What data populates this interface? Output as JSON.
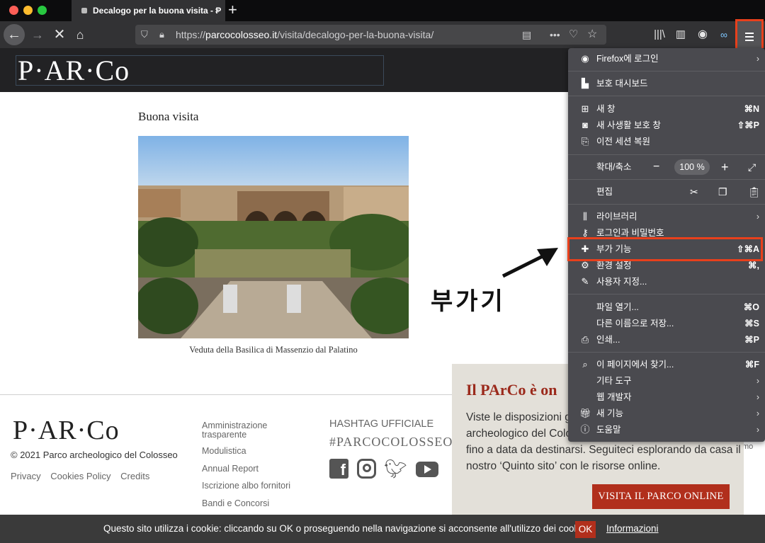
{
  "tab": {
    "title": "Decalogo per la buona visita - P",
    "close": "×",
    "new_tab": "+"
  },
  "nav": {
    "url_prefix": "https://",
    "url_domain": "parcocolosseo.it",
    "url_path": "/visita/decalogo-per-la-buona-visita/"
  },
  "site": {
    "logo": "P·AR·Co"
  },
  "content": {
    "title": "Buona visita",
    "caption": "Veduta della Basilica di Massenzio dal Palatino",
    "annotation": "부가기"
  },
  "footer": {
    "logo": "P·AR·Co",
    "copyright": "© 2021 Parco archeologico del Colosseo",
    "links": [
      "Privacy",
      "Cookies Policy",
      "Credits"
    ],
    "col_links": [
      "Amministrazione trasparente",
      "Modulistica",
      "Annual Report",
      "Iscrizione albo fornitori",
      "Bandi e Concorsi"
    ],
    "hashtag_title": "HASHTAG UFFICIALE",
    "hashtag": "#PARCOCOLOSSEO",
    "social": [
      "facebook-icon",
      "instagram-icon",
      "twitter-icon",
      "youtube-icon"
    ],
    "partial_text": "mo"
  },
  "popup": {
    "title": "Il PArCo è on",
    "body": "Viste le disposizioni go archeologico del Colo fino a data da destinarsi. Seguiteci esplorando da casa il nostro ‘Quinto sito’ con le risorse online.",
    "body_lines": [
      "Viste le disposizioni go",
      "archeologico del Colo",
      "fino a data da destinarsi. Seguiteci esplorando da casa il",
      "nostro ‘Quinto sito’ con le risorse online."
    ],
    "button": "VISITA IL PARCO ONLINE"
  },
  "cookie": {
    "text": "Questo sito utilizza i cookie: cliccando su OK o proseguendo nella navigazione si acconsente all'utilizzo dei cookie",
    "ok": "OK",
    "info": "Informazioni"
  },
  "menu": {
    "signin": "Firefox에 로그인",
    "dashboard": "보호 대시보드",
    "new_window": "새 창",
    "new_window_sc": "⌘N",
    "private_window": "새 사생활 보호 창",
    "private_window_sc": "⇧⌘P",
    "restore": "이전 세션 복원",
    "zoom_label": "확대/축소",
    "zoom_minus": "−",
    "zoom_value": "100 %",
    "zoom_plus": "+",
    "edit_label": "편집",
    "library": "라이브러리",
    "logins": "로그인과 비밀번호",
    "addons": "부가 기능",
    "addons_sc": "⇧⌘A",
    "preferences": "환경 설정",
    "preferences_sc": "⌘,",
    "customize": "사용자 지정...",
    "open_file": "파일 열기...",
    "open_file_sc": "⌘O",
    "save_as": "다른 이름으로 저장...",
    "save_as_sc": "⌘S",
    "print": "인쇄...",
    "print_sc": "⌘P",
    "find": "이 페이지에서 찾기...",
    "find_sc": "⌘F",
    "more_tools": "기타 도구",
    "web_dev": "웹 개발자",
    "whats_new": "새 기능",
    "help": "도움말"
  },
  "colors": {
    "accent_red": "#b12f1c",
    "highlight": "#e8401c",
    "menu_bg": "#4a4a4f"
  }
}
